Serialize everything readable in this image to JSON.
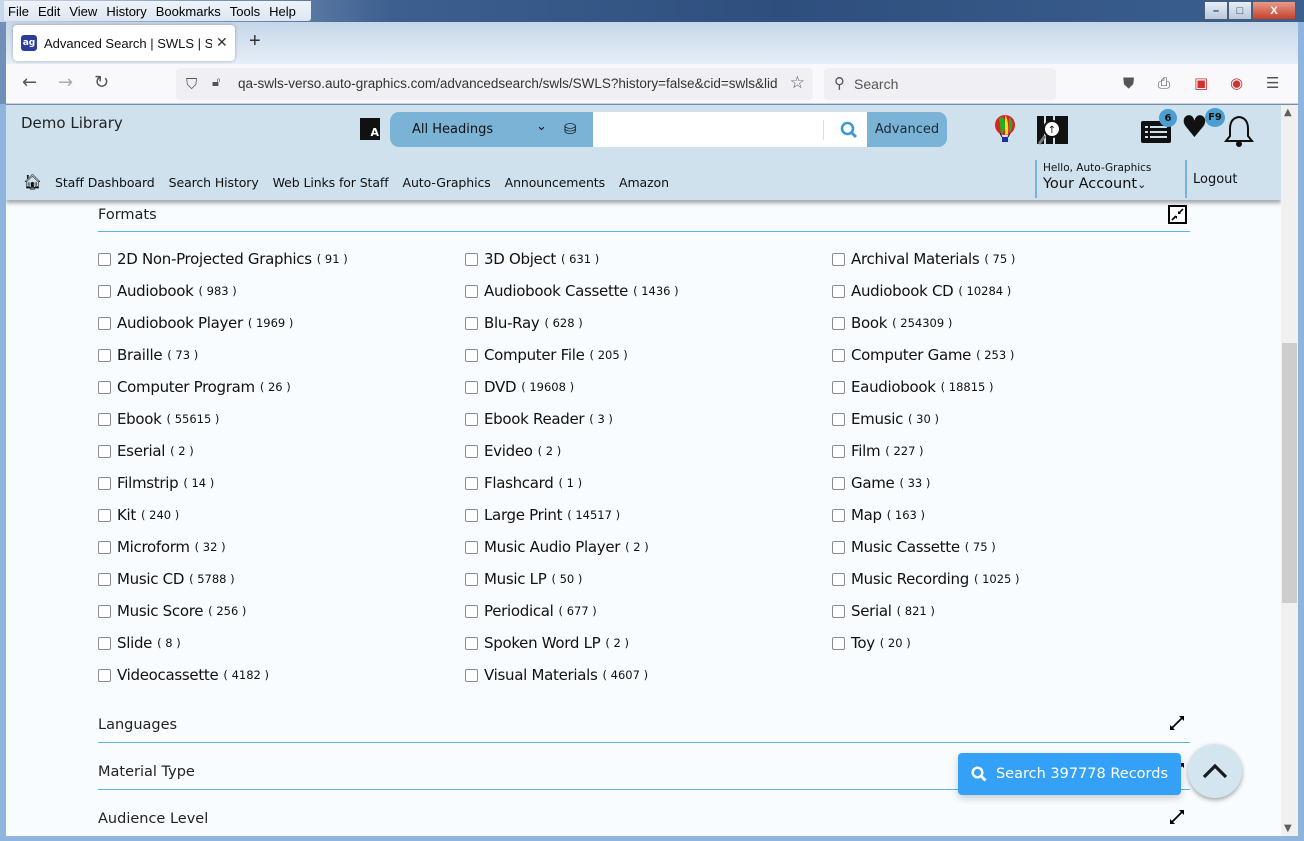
{
  "browser": {
    "menu": [
      "File",
      "Edit",
      "View",
      "History",
      "Bookmarks",
      "Tools",
      "Help"
    ],
    "menu_accel": [
      "F",
      "E",
      "V",
      "s",
      "B",
      "T",
      "H"
    ],
    "tab_title": "Advanced Search | SWLS | SWLS",
    "tab_favicon": "ag",
    "url": "qa-swls-verso.auto-graphics.com/advancedsearch/swls/SWLS?history=false&cid=swls&lid",
    "search_placeholder": "Search",
    "window_controls": {
      "minimize": "–",
      "maximize": "□",
      "close": "X"
    }
  },
  "header": {
    "library_name": "Demo Library",
    "search_scope": "All Headings",
    "search_value": "",
    "advanced_label": "Advanced",
    "list_badge": "6",
    "favorites_badge": "F9",
    "nav_links": [
      "Staff Dashboard",
      "Search History",
      "Web Links for Staff",
      "Auto-Graphics",
      "Announcements",
      "Amazon"
    ],
    "greeting": "Hello, Auto-Graphics",
    "account_label": "Your Account",
    "logout_label": "Logout"
  },
  "formats": {
    "title": "Formats",
    "items": [
      {
        "label": "2D Non-Projected Graphics",
        "count": "( 91 )"
      },
      {
        "label": "3D Object",
        "count": "( 631 )"
      },
      {
        "label": "Archival Materials",
        "count": "( 75 )"
      },
      {
        "label": "Audiobook",
        "count": "( 983 )"
      },
      {
        "label": "Audiobook Cassette",
        "count": "( 1436 )"
      },
      {
        "label": "Audiobook CD",
        "count": "( 10284 )"
      },
      {
        "label": "Audiobook Player",
        "count": "( 1969 )"
      },
      {
        "label": "Blu-Ray",
        "count": "( 628 )"
      },
      {
        "label": "Book",
        "count": "( 254309 )"
      },
      {
        "label": "Braille",
        "count": "( 73 )"
      },
      {
        "label": "Computer File",
        "count": "( 205 )"
      },
      {
        "label": "Computer Game",
        "count": "( 253 )"
      },
      {
        "label": "Computer Program",
        "count": "( 26 )"
      },
      {
        "label": "DVD",
        "count": "( 19608 )"
      },
      {
        "label": "Eaudiobook",
        "count": "( 18815 )"
      },
      {
        "label": "Ebook",
        "count": "( 55615 )"
      },
      {
        "label": "Ebook Reader",
        "count": "( 3 )"
      },
      {
        "label": "Emusic",
        "count": "( 30 )"
      },
      {
        "label": "Eserial",
        "count": "( 2 )"
      },
      {
        "label": "Evideo",
        "count": "( 2 )"
      },
      {
        "label": "Film",
        "count": "( 227 )"
      },
      {
        "label": "Filmstrip",
        "count": "( 14 )"
      },
      {
        "label": "Flashcard",
        "count": "( 1 )"
      },
      {
        "label": "Game",
        "count": "( 33 )"
      },
      {
        "label": "Kit",
        "count": "( 240 )"
      },
      {
        "label": "Large Print",
        "count": "( 14517 )"
      },
      {
        "label": "Map",
        "count": "( 163 )"
      },
      {
        "label": "Microform",
        "count": "( 32 )"
      },
      {
        "label": "Music Audio Player",
        "count": "( 2 )"
      },
      {
        "label": "Music Cassette",
        "count": "( 75 )"
      },
      {
        "label": "Music CD",
        "count": "( 5788 )"
      },
      {
        "label": "Music LP",
        "count": "( 50 )"
      },
      {
        "label": "Music Recording",
        "count": "( 1025 )"
      },
      {
        "label": "Music Score",
        "count": "( 256 )"
      },
      {
        "label": "Periodical",
        "count": "( 677 )"
      },
      {
        "label": "Serial",
        "count": "( 821 )"
      },
      {
        "label": "Slide",
        "count": "( 8 )"
      },
      {
        "label": "Spoken Word LP",
        "count": "( 2 )"
      },
      {
        "label": "Toy",
        "count": "( 20 )"
      },
      {
        "label": "Videocassette",
        "count": "( 4182 )"
      },
      {
        "label": "Visual Materials",
        "count": "( 4607 )"
      }
    ]
  },
  "sections": {
    "languages": "Languages",
    "material_type": "Material Type",
    "audience_level": "Audience Level"
  },
  "search_records_label": "Search 397778 Records",
  "colors": {
    "header_bg": "#cfe1ec",
    "accent": "#7ab3d6",
    "search_button": "#34a1f7",
    "divider": "#5ab8e0"
  }
}
